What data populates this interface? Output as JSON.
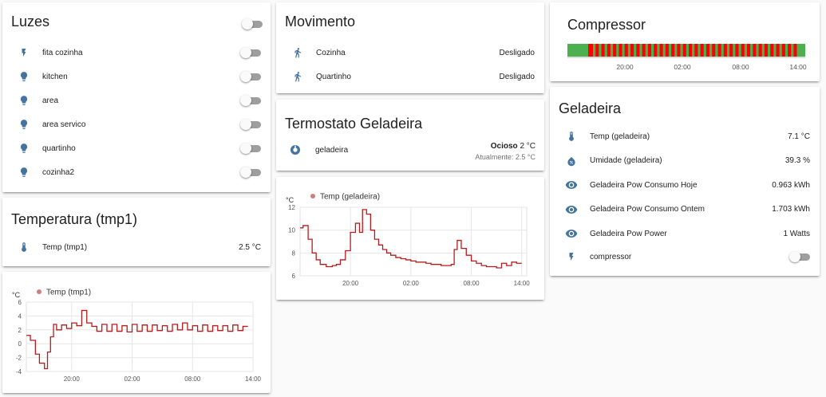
{
  "colors": {
    "icon": "#44739e",
    "line": "#b71c1c",
    "legend_dot": "#d07f7f",
    "compressor_on": "#ff0000",
    "compressor_off": "#4caf50"
  },
  "luzes": {
    "title": "Luzes",
    "items": [
      {
        "label": "fita cozinha",
        "icon": "flash-icon"
      },
      {
        "label": "kitchen",
        "icon": "lightbulb-icon"
      },
      {
        "label": "area",
        "icon": "lightbulb-icon"
      },
      {
        "label": "area servico",
        "icon": "lightbulb-icon"
      },
      {
        "label": "quartinho",
        "icon": "lightbulb-icon"
      },
      {
        "label": "cozinha2",
        "icon": "lightbulb-icon"
      }
    ]
  },
  "temperatura": {
    "title": "Temperatura (tmp1)",
    "row": {
      "label": "Temp (tmp1)",
      "value": "2.5 °C",
      "icon": "thermometer-icon"
    }
  },
  "movimento": {
    "title": "Movimento",
    "items": [
      {
        "label": "Cozinha",
        "value": "Desligado",
        "icon": "walk-icon"
      },
      {
        "label": "Quartinho",
        "value": "Desligado",
        "icon": "walk-icon"
      }
    ]
  },
  "termostato": {
    "title": "Termostato Geladeira",
    "name": "geladeira",
    "state": "Ocioso",
    "target": "2 °C",
    "current": "Atualmente: 2.5 °C"
  },
  "compressor": {
    "title": "Compressor",
    "ticks": [
      "20:00",
      "02:00",
      "08:00",
      "14:00"
    ]
  },
  "geladeira": {
    "title": "Geladeira",
    "items": [
      {
        "label": "Temp (geladeira)",
        "value": "7.1 °C",
        "icon": "thermometer-icon"
      },
      {
        "label": "Umidade (geladeira)",
        "value": "39.3 %",
        "icon": "water-percent-icon"
      },
      {
        "label": "Geladeira Pow Consumo Hoje",
        "value": "0.963 kWh",
        "icon": "eye-icon"
      },
      {
        "label": "Geladeira Pow Consumo Ontem",
        "value": "1.703 kWh",
        "icon": "eye-icon"
      },
      {
        "label": "Geladeira Pow Power",
        "value": "1 Watts",
        "icon": "eye-icon"
      }
    ],
    "switch": {
      "label": "compressor",
      "icon": "flash-icon"
    }
  },
  "chart_data": [
    {
      "type": "line",
      "name": "tmp1",
      "ylabel": "°C",
      "series": [
        {
          "name": "Temp (tmp1)",
          "x": [
            0,
            0.4,
            0.9,
            1.3,
            1.8,
            2.1,
            2.4,
            2.7,
            3.0,
            3.5,
            4.0,
            4.5,
            5.0,
            5.5,
            6.0,
            6.5,
            7.0,
            7.5,
            8.0,
            8.5,
            9.0,
            9.5,
            10.0,
            10.5,
            11.0,
            11.5,
            12.0,
            12.5,
            13.0,
            13.5,
            14.0,
            14.5,
            15.0,
            15.5,
            16.0,
            16.5,
            17.0,
            17.5,
            18.0,
            18.5,
            19.0,
            19.5,
            20.0,
            20.5,
            21.0,
            21.5,
            22.0
          ],
          "y": [
            1.2,
            0.5,
            -1.5,
            -2.8,
            -3.6,
            -1.2,
            1.0,
            2.8,
            2.0,
            2.7,
            2.2,
            3.0,
            2.6,
            4.8,
            3.0,
            2.5,
            1.8,
            2.8,
            1.8,
            2.8,
            1.8,
            2.6,
            1.7,
            2.8,
            1.8,
            2.7,
            1.8,
            2.7,
            1.9,
            2.6,
            1.8,
            2.8,
            2.0,
            3.0,
            2.0,
            2.6,
            1.8,
            2.7,
            1.8,
            2.6,
            1.9,
            2.6,
            1.8,
            2.7,
            1.9,
            2.5,
            2.5
          ]
        }
      ],
      "ylim": [
        -4,
        6
      ],
      "yticks": [
        "6",
        "4",
        "2",
        "0",
        "-2",
        "-4"
      ],
      "xticks": [
        "20:00",
        "02:00",
        "08:00",
        "14:00"
      ],
      "xtick_pos": [
        4.5,
        10.5,
        16.5,
        22.5
      ],
      "xlim": [
        0,
        22.5
      ]
    },
    {
      "type": "line",
      "name": "geladeira",
      "ylabel": "°C",
      "series": [
        {
          "name": "Temp (geladeira)",
          "x": [
            0,
            0.3,
            0.8,
            1.2,
            1.6,
            2.0,
            2.6,
            3.2,
            3.6,
            4.0,
            4.5,
            5.0,
            5.5,
            5.9,
            6.2,
            6.6,
            7.0,
            7.4,
            7.8,
            8.2,
            8.6,
            9.0,
            9.5,
            10.0,
            10.5,
            11.0,
            11.5,
            12.0,
            12.5,
            13.0,
            13.5,
            14.0,
            14.5,
            15.0,
            15.3,
            15.6,
            16.0,
            16.5,
            17.0,
            17.5,
            18.0,
            18.5,
            19.0,
            19.5,
            20.0,
            20.5,
            21.0,
            21.5,
            22.0
          ],
          "y": [
            10.2,
            10.4,
            9.2,
            8.0,
            7.4,
            7.0,
            6.8,
            6.9,
            7.0,
            7.4,
            8.2,
            9.8,
            10.6,
            9.8,
            11.8,
            11.4,
            10.0,
            9.2,
            8.7,
            8.3,
            8.0,
            7.8,
            7.6,
            7.5,
            7.4,
            7.3,
            7.2,
            7.2,
            7.1,
            7.0,
            7.0,
            6.9,
            6.9,
            7.0,
            8.3,
            9.1,
            8.4,
            7.8,
            7.3,
            7.1,
            6.9,
            6.8,
            6.8,
            6.7,
            7.1,
            6.9,
            7.2,
            7.1,
            7.1
          ]
        }
      ],
      "ylim": [
        6,
        12
      ],
      "yticks": [
        "12",
        "10",
        "8",
        "6"
      ],
      "xticks": [
        "20:00",
        "02:00",
        "08:00",
        "14:00"
      ],
      "xtick_pos": [
        5.0,
        11.0,
        17.0,
        22.0
      ],
      "xlim": [
        0,
        22.5
      ]
    }
  ]
}
